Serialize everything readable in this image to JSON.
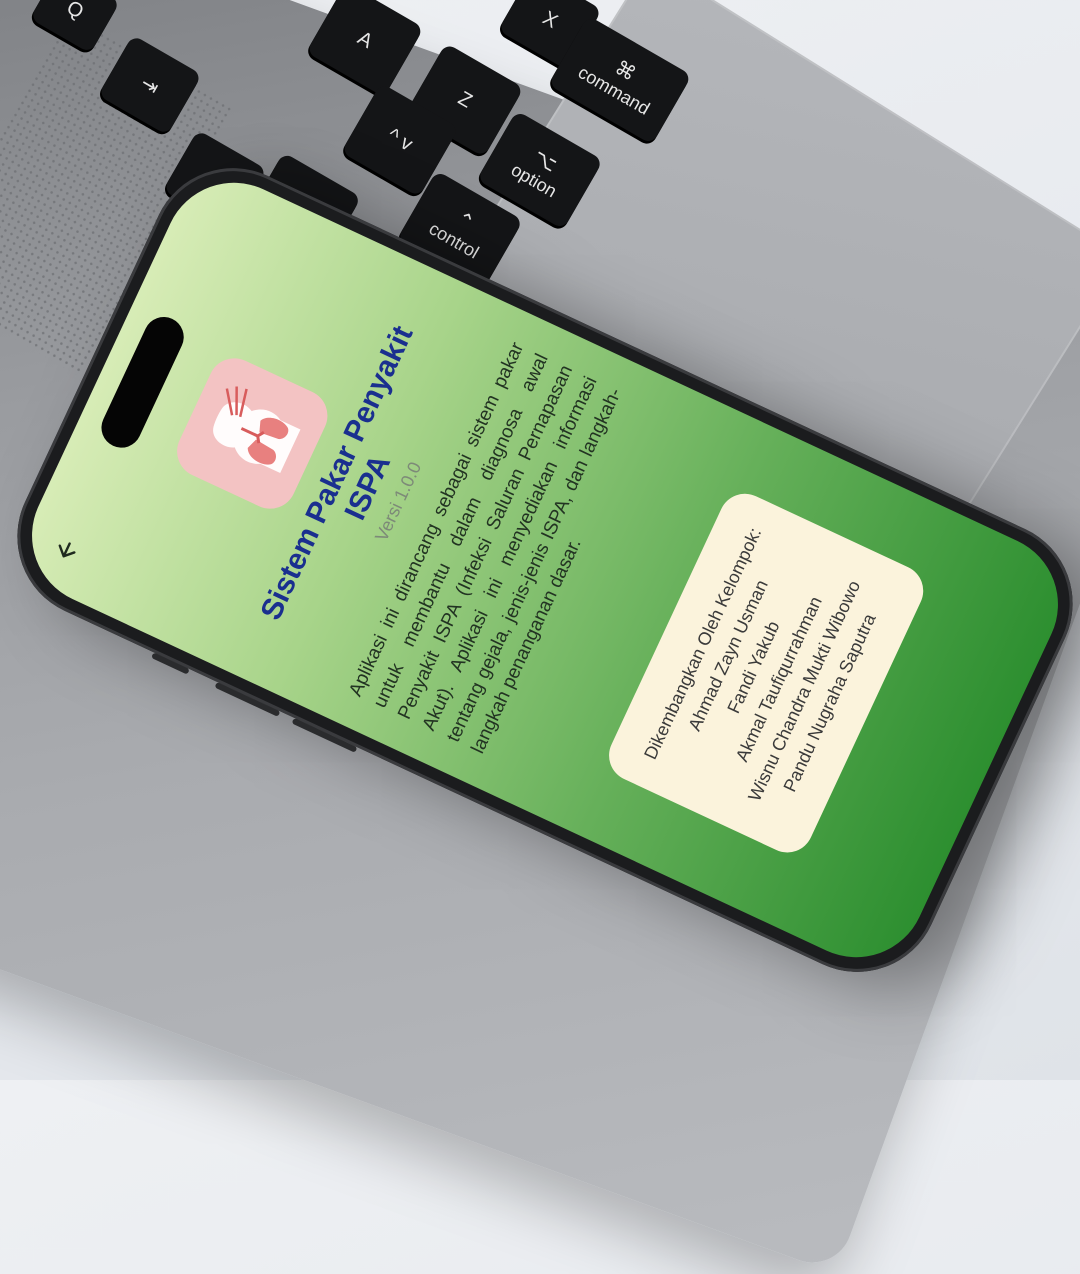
{
  "keyboard": {
    "keys": [
      "Q",
      "A",
      "Z",
      "X",
      "⇥",
      "⇪",
      "⌥",
      "⌃",
      "⌘"
    ],
    "labels": {
      "command": "command",
      "option": "option",
      "control": "control"
    }
  },
  "app": {
    "back_icon": "back-arrow-icon",
    "logo_icon": "lungs-icon",
    "title": "Sistem Pakar Penyakit ISPA",
    "version": "Versi 1.0.0",
    "description": "Aplikasi ini dirancang sebagai sistem pakar untuk membantu dalam diagnosa awal Penyakit ISPA (Infeksi Saluran Pernapasan Akut). Aplikasi ini menyediakan informasi tentang gejala, jenis-jenis ISPA, dan langkah-langkah penanganan dasar.",
    "developers": {
      "heading": "Dikembangkan Oleh Kelompok:",
      "members": [
        "Ahmad Zayn Usman",
        "Fandi Yakub",
        "Akmal Taufiqurrahman",
        "Wisnu Chandra Mukti Wibowo",
        "Pandu Nugraha Saputra"
      ]
    }
  },
  "colors": {
    "title": "#1a2f8f",
    "card": "#fbf3dc",
    "gradient_top": "#d7ecb6",
    "gradient_bottom": "#2d8f30",
    "logo_bg": "#f3c3c3"
  }
}
